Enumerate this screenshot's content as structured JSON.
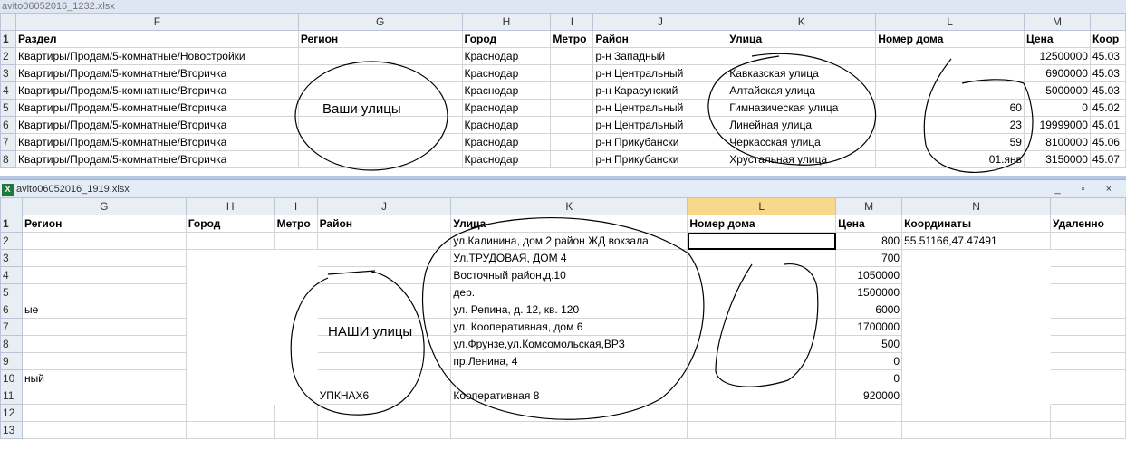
{
  "window1": {
    "title": "avito06052016_1232.xlsx",
    "columns": [
      "F",
      "G",
      "H",
      "I",
      "J",
      "K",
      "L",
      "M",
      ""
    ],
    "rows": [
      {
        "n": "1",
        "cells": [
          "Раздел",
          "Регион",
          "Город",
          "Метро",
          "Район",
          "Улица",
          "Номер дома",
          "Цена",
          "Коор"
        ]
      },
      {
        "n": "2",
        "cells": [
          "Квартиры/Продам/5-комнатные/Новостройки",
          "",
          "Краснодар",
          "",
          "р-н Западный",
          "",
          "",
          "12500000",
          "45.03"
        ]
      },
      {
        "n": "3",
        "cells": [
          "Квартиры/Продам/5-комнатные/Вторичка",
          "",
          "Краснодар",
          "",
          "р-н Центральный",
          "Кавказская улица",
          "",
          "6900000",
          "45.03"
        ]
      },
      {
        "n": "4",
        "cells": [
          "Квартиры/Продам/5-комнатные/Вторичка",
          "",
          "Краснодар",
          "",
          "р-н Карасунский",
          "Алтайская улица",
          "",
          "5000000",
          "45.03"
        ]
      },
      {
        "n": "5",
        "cells": [
          "Квартиры/Продам/5-комнатные/Вторичка",
          "",
          "Краснодар",
          "",
          "р-н Центральный",
          "Гимназическая улица",
          "60",
          "0",
          "45.02"
        ]
      },
      {
        "n": "6",
        "cells": [
          "Квартиры/Продам/5-комнатные/Вторичка",
          "",
          "Краснодар",
          "",
          "р-н Центральный",
          "Линейная улица",
          "23",
          "19999000",
          "45.01"
        ]
      },
      {
        "n": "7",
        "cells": [
          "Квартиры/Продам/5-комнатные/Вторичка",
          "",
          "Краснодар",
          "",
          "р-н Прикубански",
          "Черкасская улица",
          "59",
          "8100000",
          "45.06"
        ]
      },
      {
        "n": "8",
        "cells": [
          "Квартиры/Продам/5-комнатные/Вторичка",
          "",
          "Краснодар",
          "",
          "р-н Прикубански",
          "Хрустальная улица",
          "01.янв",
          "3150000",
          "45.07"
        ]
      }
    ],
    "annotation": "Ваши улицы"
  },
  "window2": {
    "title": "avito06052016_1919.xlsx",
    "columns": [
      "G",
      "H",
      "I",
      "J",
      "K",
      "L",
      "M",
      "N",
      ""
    ],
    "rows": [
      {
        "n": "1",
        "cells": [
          "Регион",
          "Город",
          "Метро",
          "Район",
          "Улица",
          "Номер дома",
          "Цена",
          "Координаты",
          "Удаленно"
        ]
      },
      {
        "n": "2",
        "cells": [
          "",
          "",
          "",
          "",
          "ул.Калинина, дом 2 район ЖД вокзала.",
          "",
          "800",
          "55.51166,47.47491",
          ""
        ]
      },
      {
        "n": "3",
        "cells": [
          "",
          "",
          "",
          "",
          "Ул.ТРУДОВАЯ, ДОМ 4",
          "",
          "700",
          "",
          ""
        ]
      },
      {
        "n": "4",
        "cells": [
          "",
          "",
          "",
          "",
          "Восточный район,д.10",
          "",
          "1050000",
          "",
          ""
        ]
      },
      {
        "n": "5",
        "cells": [
          "",
          "",
          "",
          "",
          "дер.",
          "",
          "1500000",
          "",
          ""
        ]
      },
      {
        "n": "6",
        "cells": [
          "ые",
          "",
          "",
          "",
          "ул. Репина, д. 12, кв. 120",
          "",
          "6000",
          "",
          ""
        ]
      },
      {
        "n": "7",
        "cells": [
          "",
          "",
          "",
          "",
          "ул. Кооперативная, дом 6",
          "",
          "1700000",
          "",
          ""
        ]
      },
      {
        "n": "8",
        "cells": [
          "",
          "",
          "",
          "",
          "ул.Фрунзе,ул.Комсомольская,ВРЗ",
          "",
          "500",
          "",
          ""
        ]
      },
      {
        "n": "9",
        "cells": [
          "",
          "",
          "",
          "",
          "пр.Ленина, 4",
          "",
          "0",
          "",
          ""
        ]
      },
      {
        "n": "10",
        "cells": [
          "ный",
          "",
          "",
          "",
          "",
          "",
          "0",
          "",
          ""
        ]
      },
      {
        "n": "11",
        "cells": [
          "",
          "",
          "",
          "УПКНАХ6",
          "Кооперативная 8",
          "",
          "920000",
          "",
          ""
        ]
      },
      {
        "n": "12",
        "cells": [
          "",
          "",
          "",
          "",
          "",
          "",
          "",
          "",
          ""
        ]
      },
      {
        "n": "13",
        "cells": [
          "",
          "",
          "",
          "",
          "",
          "",
          "",
          "",
          ""
        ]
      }
    ],
    "annotation": "НАШИ улицы",
    "window_buttons": "_ ▫ ×"
  }
}
